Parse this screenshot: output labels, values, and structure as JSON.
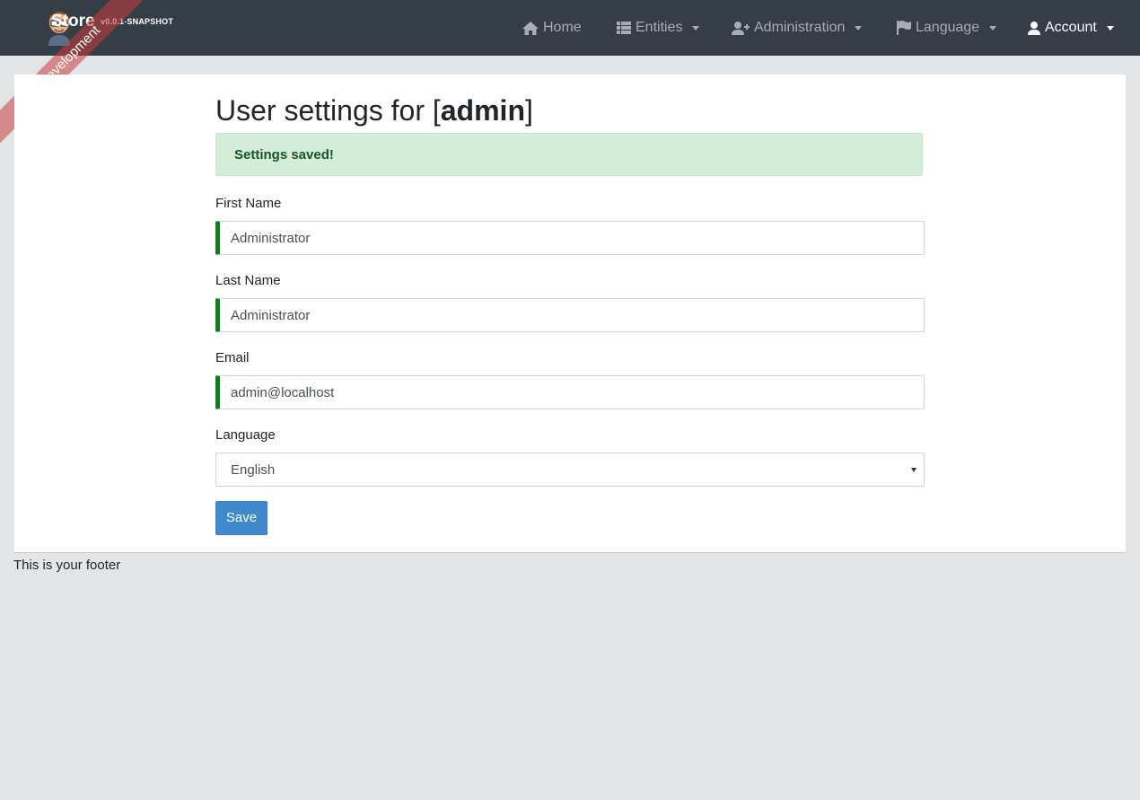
{
  "navbar": {
    "brand_title": "Store",
    "brand_version": "v0.0.1-SNAPSHOT",
    "ribbon": "Development",
    "items": [
      {
        "label": "Home",
        "icon": "home-icon"
      },
      {
        "label": "Entities",
        "icon": "table-list-icon"
      },
      {
        "label": "Administration",
        "icon": "user-plus-icon"
      },
      {
        "label": "Language",
        "icon": "flag-icon"
      },
      {
        "label": "Account",
        "icon": "user-icon"
      }
    ]
  },
  "page": {
    "title_prefix": "User settings for [",
    "title_user": "admin",
    "title_suffix": "]",
    "alert": "Settings saved!",
    "form": {
      "first_name_label": "First Name",
      "first_name_value": "Administrator",
      "last_name_label": "Last Name",
      "last_name_value": "Administrator",
      "email_label": "Email",
      "email_value": "admin@localhost",
      "language_label": "Language",
      "language_value": "English",
      "save_label": "Save"
    }
  },
  "footer": {
    "text": "This is your footer"
  },
  "colors": {
    "navbar_bg": "#353d47",
    "page_bg": "#e4e5e6",
    "alert_bg": "#d4edda",
    "alert_text": "#155724",
    "valid_border": "#117d1c",
    "primary": "#3e8acc"
  }
}
